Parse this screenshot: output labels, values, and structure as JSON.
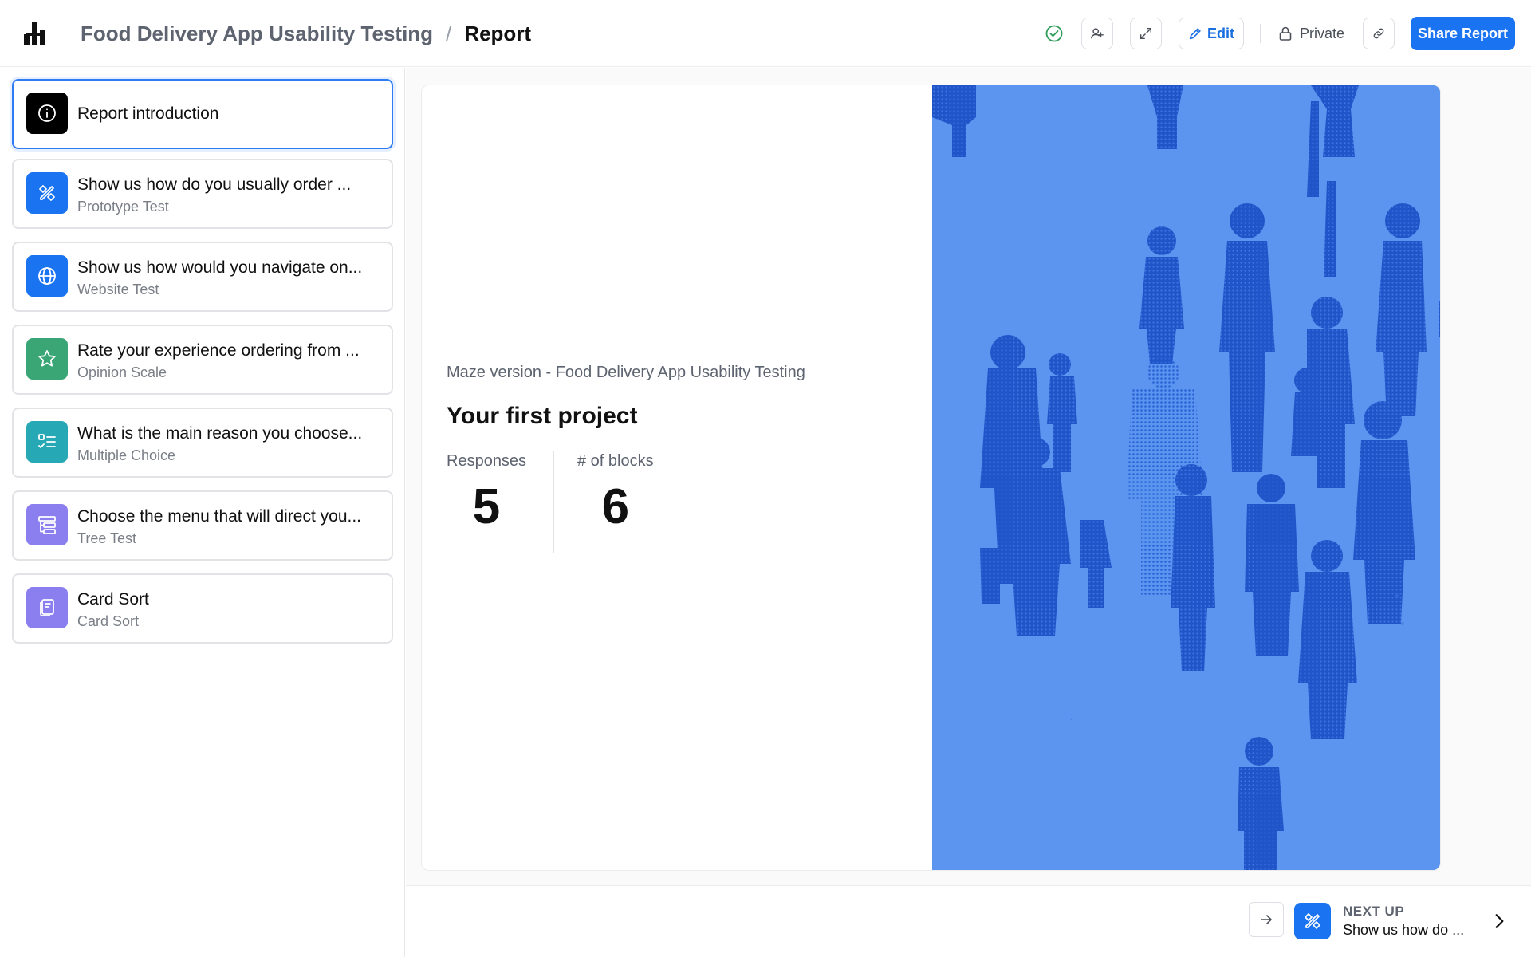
{
  "header": {
    "project_name": "Food Delivery App Usability Testing",
    "separator": "/",
    "page_name": "Report",
    "edit_label": "Edit",
    "privacy_label": "Private",
    "share_label": "Share Report",
    "icons": [
      "logo-icon",
      "check-circle-icon",
      "add-user-icon",
      "expand-icon",
      "pencil-icon",
      "lock-icon",
      "link-icon"
    ]
  },
  "sidebar": {
    "items": [
      {
        "title": "Report introduction",
        "subtitle": "",
        "icon": "info-icon",
        "color": "#000000",
        "active": true
      },
      {
        "title": "Show us how do you usually order ...",
        "subtitle": "Prototype Test",
        "icon": "prototype-icon",
        "color": "#1a73f0"
      },
      {
        "title": "Show us how would you navigate on...",
        "subtitle": "Website Test",
        "icon": "globe-icon",
        "color": "#1a73f0"
      },
      {
        "title": "Rate your experience ordering from ...",
        "subtitle": "Opinion Scale",
        "icon": "star-icon",
        "color": "#3aa676"
      },
      {
        "title": "What is the main reason you choose...",
        "subtitle": "Multiple Choice",
        "icon": "checklist-icon",
        "color": "#27a9b5"
      },
      {
        "title": "Choose the menu that will direct you...",
        "subtitle": "Tree Test",
        "icon": "tree-icon",
        "color": "#8b7ff0"
      },
      {
        "title": "Card Sort",
        "subtitle": "Card Sort",
        "icon": "cards-icon",
        "color": "#8b7ff0"
      }
    ]
  },
  "intro": {
    "maze_version": "Maze version - Food Delivery App Usability Testing",
    "project_title": "Your first project",
    "responses_label": "Responses",
    "responses_value": "5",
    "blocks_label": "# of blocks",
    "blocks_value": "6",
    "image_color": "#5b95ef"
  },
  "footer": {
    "next_up_label": "NEXT UP",
    "next_up_title": "Show us how do ...",
    "icons": [
      "arrow-right-icon",
      "prototype-icon",
      "chevron-right-icon"
    ]
  }
}
